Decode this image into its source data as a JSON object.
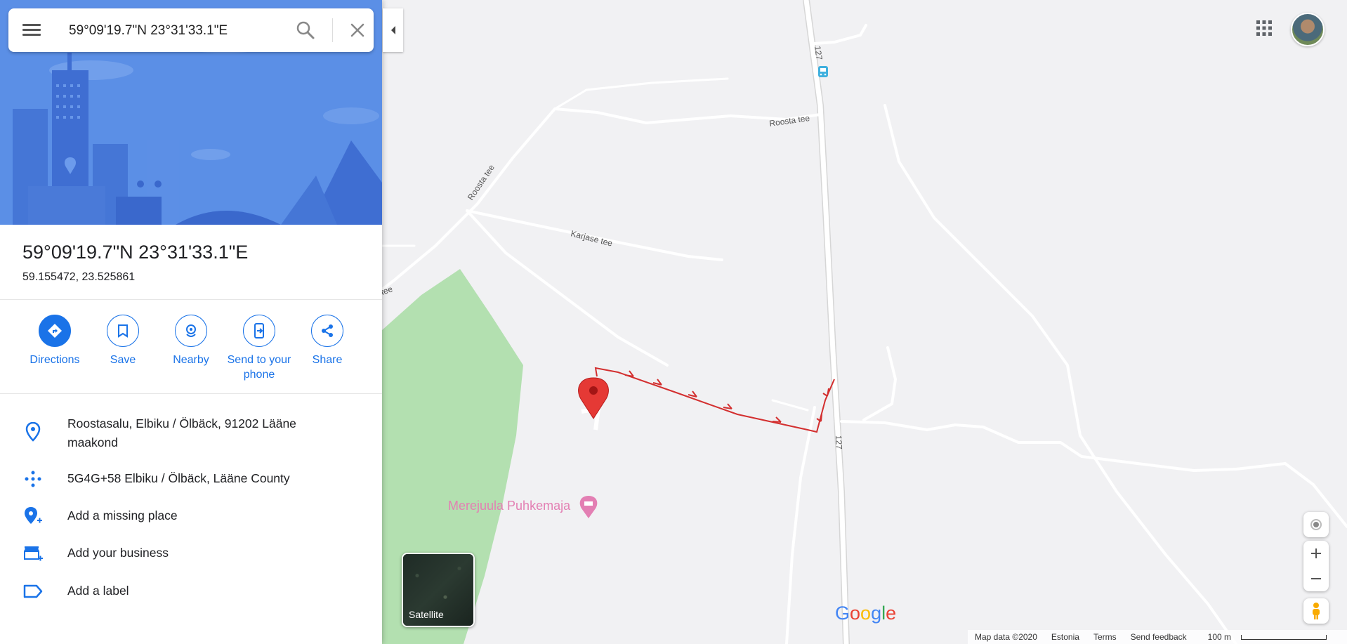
{
  "search": {
    "value": "59°09'19.7\"N 23°31'33.1\"E"
  },
  "place": {
    "title": "59°09'19.7\"N 23°31'33.1\"E",
    "coordinates": "59.155472, 23.525861"
  },
  "actions": [
    {
      "label": "Directions",
      "icon": "directions-icon"
    },
    {
      "label": "Save",
      "icon": "bookmark-icon"
    },
    {
      "label": "Nearby",
      "icon": "nearby-icon"
    },
    {
      "label": "Send to your phone",
      "icon": "send-to-phone-icon"
    },
    {
      "label": "Share",
      "icon": "share-icon"
    }
  ],
  "info": [
    {
      "text": "Roostasalu, Elbiku / Ölbäck, 91202 Lääne maakond",
      "icon": "location-pin-icon"
    },
    {
      "text": "5G4G+58 Elbiku / Ölbäck, Lääne County",
      "icon": "plus-code-icon"
    },
    {
      "text": "Add a missing place",
      "icon": "add-place-icon"
    },
    {
      "text": "Add your business",
      "icon": "add-business-icon"
    },
    {
      "text": "Add a label",
      "icon": "label-icon"
    }
  ],
  "map": {
    "labels": {
      "road_127_top": "127",
      "road_127_bottom": "127",
      "roosta_tee_1": "Roosta tee",
      "roosta_tee_2": "Roosta tee",
      "roosta_tee_3": "tee",
      "karjase_tee": "Karjase tee",
      "poi": "Merejuula Puhkemaja"
    },
    "satellite_label": "Satellite",
    "logo": [
      "G",
      "o",
      "o",
      "g",
      "l",
      "e"
    ],
    "colors": {
      "background": "#eeeeee",
      "road": "#ffffff",
      "forest": "#b3e0b0",
      "pin": "#e53935",
      "arrow": "#d32f2f",
      "poi": "#e37fb3",
      "accent": "#1a73e8"
    }
  },
  "footer": {
    "map_data": "Map data ©2020",
    "country": "Estonia",
    "terms": "Terms",
    "feedback": "Send feedback",
    "scale": "100 m"
  }
}
